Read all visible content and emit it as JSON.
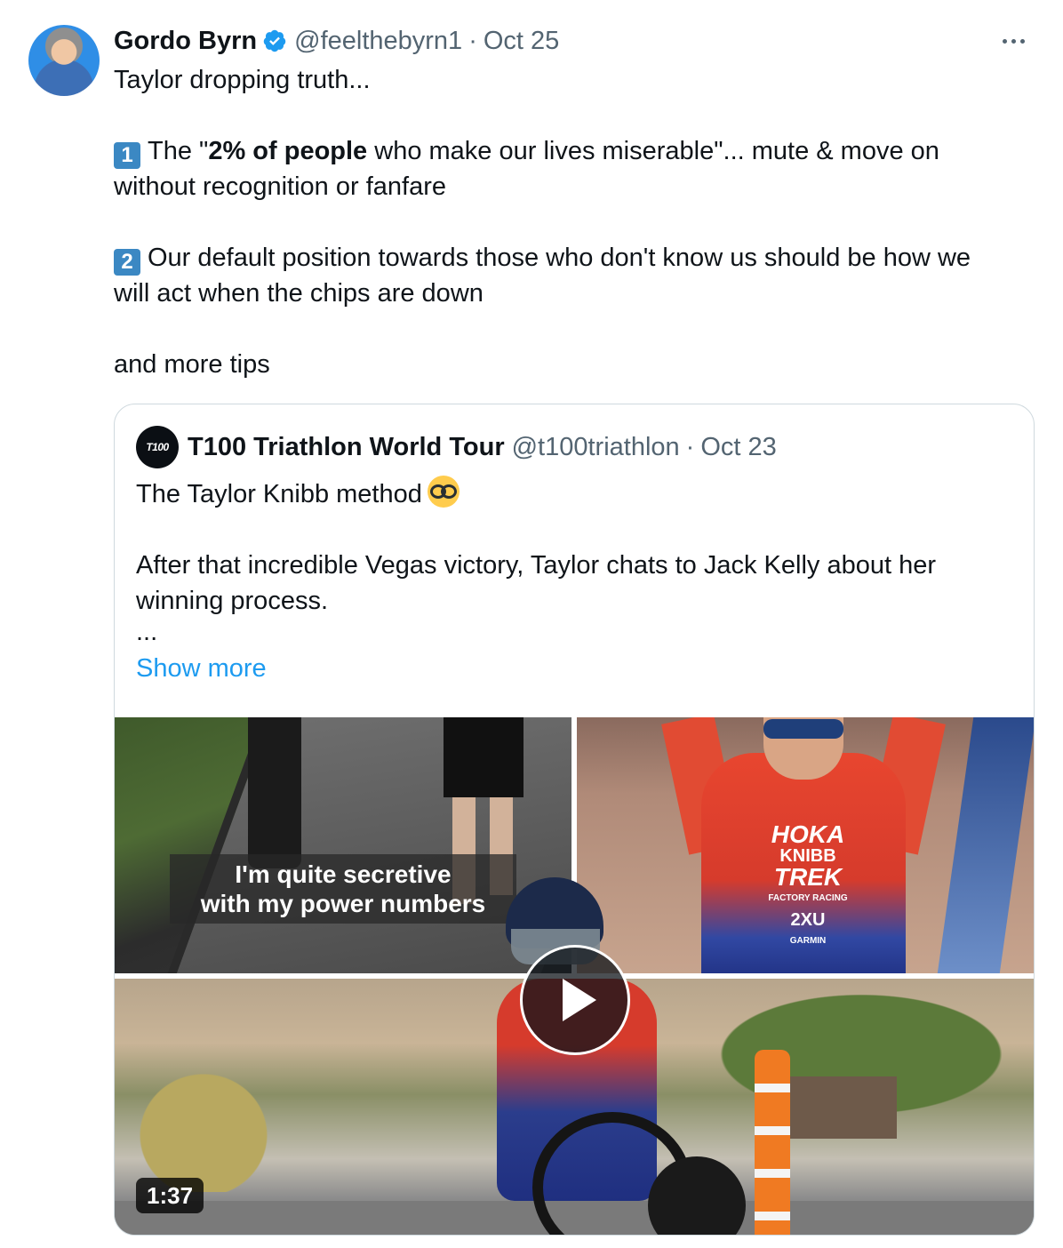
{
  "tweet": {
    "author_name": "Gordo Byrn",
    "handle": "@feelthebyrn1",
    "separator": "·",
    "date": "Oct 25",
    "line1": "Taylor dropping truth...",
    "point1_key": "1",
    "point1_pre": "The \"",
    "point1_bold": "2% of people",
    "point1_post": " who make our lives miserable\"... mute & move on without recognition or fanfare",
    "point2_key": "2",
    "point2_text": "Our default position towards those who don't know us should be how we will act when the chips are down",
    "closing": "and more tips"
  },
  "quoted": {
    "logo_text": "T100",
    "author_name": "T100 Triathlon World Tour",
    "handle": "@t100triathlon",
    "separator": "·",
    "date": "Oct 23",
    "line1": "The Taylor Knibb method",
    "line2": "After that incredible Vegas victory, Taylor chats to Jack Kelly about her winning process.",
    "ellipsis": "...",
    "show_more": "Show more",
    "video_caption_line1": "I'm quite secretive",
    "video_caption_line2": "with my power numbers",
    "jersey_brand": "HOKA",
    "jersey_name": "KNIBB",
    "jersey_sponsor1": "TREK",
    "jersey_sponsor1_sub": "FACTORY RACING",
    "jersey_sponsor2": "2XU",
    "jersey_sponsor3": "GARMIN",
    "video_duration": "1:37"
  },
  "icons": {
    "verified": "verified-badge-icon",
    "more": "more-options-icon",
    "play": "play-icon",
    "emoji": "disguised-face-emoji"
  },
  "colors": {
    "accent": "#1d9bf0",
    "secondary_text": "#536471",
    "keycap": "#3b88c3"
  }
}
